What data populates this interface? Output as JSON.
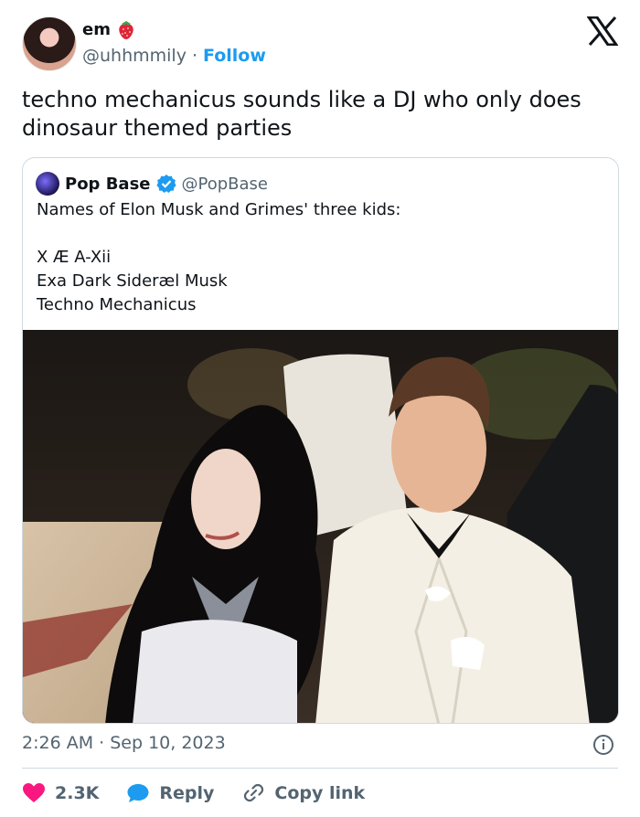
{
  "author": {
    "name": "em",
    "handle": "@uhhmmily",
    "separator": "·",
    "follow_label": "Follow",
    "emoji_icon": "strawberry-icon"
  },
  "tweet": {
    "text": "techno mechanicus sounds like a DJ who only does dinosaur themed parties",
    "timestamp": "2:26 AM · Sep 10, 2023"
  },
  "quoted": {
    "name": "Pop Base",
    "handle": "@PopBase",
    "lines": [
      "Names of Elon Musk and Grimes' three kids:",
      "",
      "X Æ A-Xii",
      "Exa Dark Sideræl Musk",
      "Techno Mechanicus"
    ]
  },
  "actions": {
    "likes": "2.3K",
    "reply_label": "Reply",
    "copy_label": "Copy link"
  },
  "colors": {
    "accent": "#1d9bf0",
    "like": "#f91880",
    "text": "#0f1419",
    "muted": "#536471"
  }
}
